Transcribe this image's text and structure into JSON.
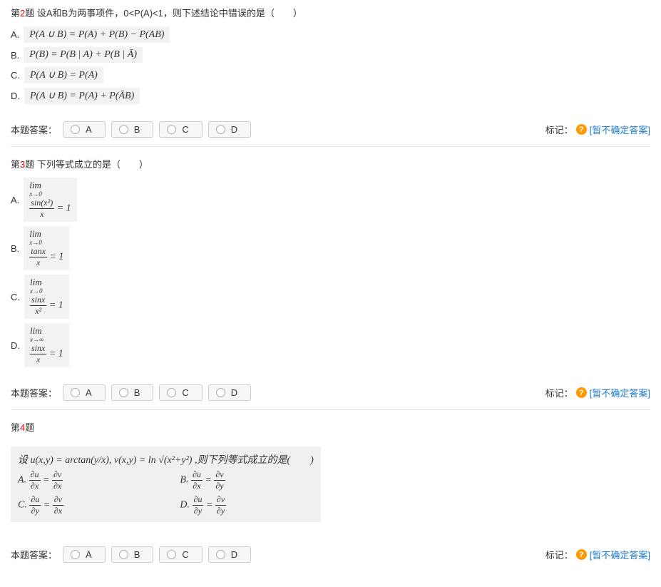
{
  "questions": [
    {
      "number": "2",
      "prefix": "第",
      "suffix_label": "题",
      "stem": "设A和B为两事项件，0<P(A)<1，则下述结论中错误的是（　　）",
      "options": [
        {
          "letter": "A.",
          "formula": "P(A ∪ B) = P(A) + P(B) − P(AB)"
        },
        {
          "letter": "B.",
          "formula": "P(B) = P(B | A) + P(B | Ā)"
        },
        {
          "letter": "C.",
          "formula": "P(A ∪ B) = P(A)"
        },
        {
          "letter": "D.",
          "formula": "P(A ∪ B) = P(A) + P(ĀB)"
        }
      ]
    },
    {
      "number": "3",
      "prefix": "第",
      "suffix_label": "题",
      "stem": "下列等式成立的是（　　）",
      "options": [
        {
          "letter": "A.",
          "formula": "lim(x→0) sin(x²)/x = 1"
        },
        {
          "letter": "B.",
          "formula": "lim(x→0) tanx/x = 1"
        },
        {
          "letter": "C.",
          "formula": "lim(x→0) sinx/x² = 1"
        },
        {
          "letter": "D.",
          "formula": "lim(x→∞) sinx/x = 1"
        }
      ]
    },
    {
      "number": "4",
      "prefix": "第",
      "suffix_label": "题",
      "stem_block": "设 u(x,y) = arctan(y/x), v(x,y) = ln √(x²+y²) ,则下列等式成立的是(　　)",
      "sub_options": [
        {
          "letter": "A.",
          "formula": "∂u/∂x = ∂v/∂x"
        },
        {
          "letter": "B.",
          "formula": "∂u/∂x = ∂v/∂y"
        },
        {
          "letter": "C.",
          "formula": "∂u/∂y = ∂v/∂x"
        },
        {
          "letter": "D.",
          "formula": "∂u/∂y = ∂v/∂y"
        }
      ]
    }
  ],
  "ui": {
    "answer_label": "本题答案：",
    "choices": [
      "A",
      "B",
      "C",
      "D"
    ],
    "mark_label": "标记：",
    "help_icon": "?",
    "unsure_text": "[暂不确定答案]"
  }
}
